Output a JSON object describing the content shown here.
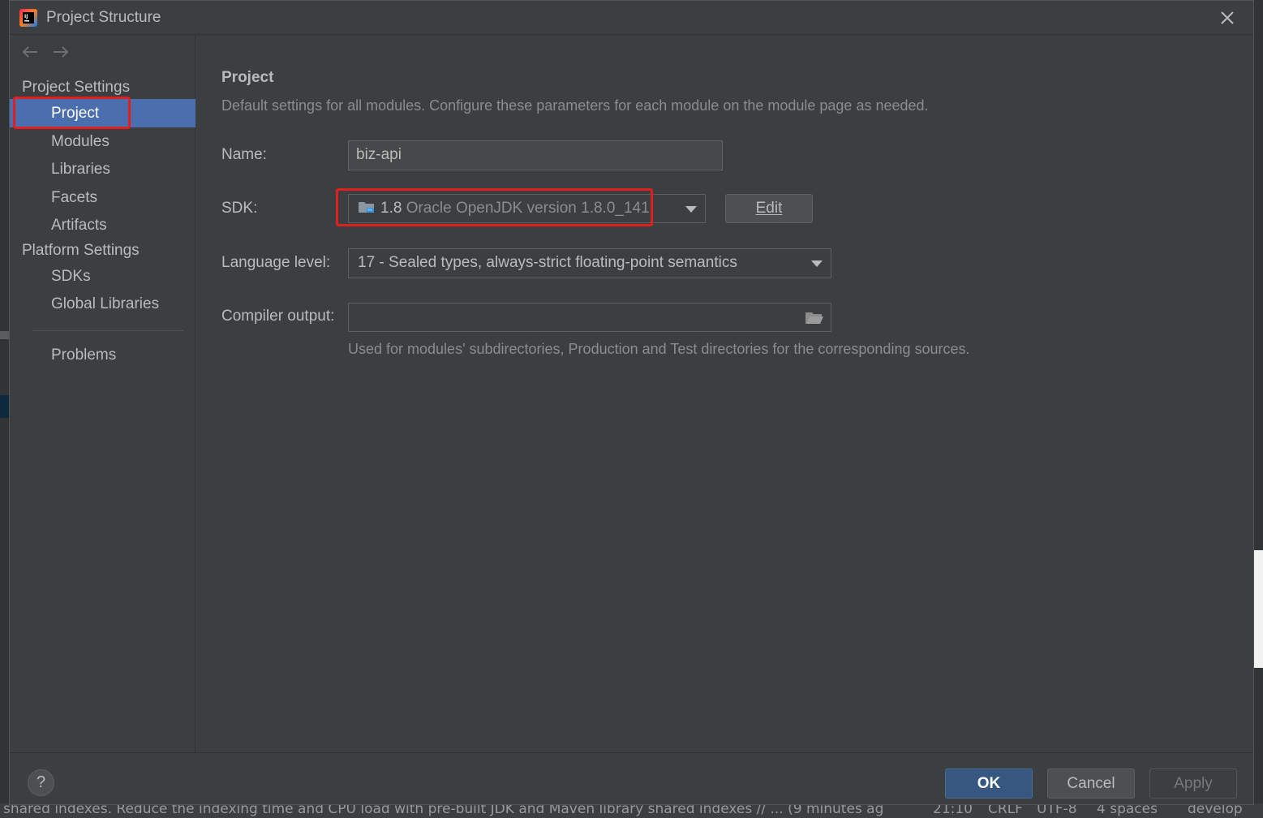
{
  "window": {
    "title": "Project Structure",
    "close_icon": "close-icon",
    "app_icon": "intellij-idea-icon"
  },
  "sidebar": {
    "back_icon": "arrow-left-icon",
    "forward_icon": "arrow-right-icon",
    "project_settings_title": "Project Settings",
    "project_settings_items": [
      "Project",
      "Modules",
      "Libraries",
      "Facets",
      "Artifacts"
    ],
    "platform_settings_title": "Platform Settings",
    "platform_settings_items": [
      "SDKs",
      "Global Libraries"
    ],
    "problems_label": "Problems",
    "selected_item": "Project"
  },
  "main": {
    "title": "Project",
    "description": "Default settings for all modules. Configure these parameters for each module on the module page as needed.",
    "name_label": "Name:",
    "name_value": "biz-api",
    "sdk_label": "SDK:",
    "sdk_version": "1.8",
    "sdk_description": "Oracle OpenJDK version 1.8.0_141",
    "sdk_edit_label": "Edit",
    "language_level_label": "Language level:",
    "language_level_value": "17 - Sealed types, always-strict floating-point semantics",
    "compiler_output_label": "Compiler output:",
    "compiler_output_value": "",
    "compiler_output_hint": "Used for modules' subdirectories, Production and Test directories for the corresponding sources."
  },
  "footer": {
    "help_label": "?",
    "ok_label": "OK",
    "cancel_label": "Cancel",
    "apply_label": "Apply"
  },
  "status_bar": {
    "message": "shared indexes. Reduce the indexing time and CPU load with pre-built JDK and Maven library shared indexes // ... (9 minutes ag",
    "position": "21:10",
    "line_separator": "CRLF",
    "encoding": "UTF-8",
    "indent": "4 spaces",
    "branch": "develop"
  },
  "colors": {
    "selection": "#4b6eaf",
    "highlight_box": "#e02020",
    "ok_button": "#365880"
  }
}
